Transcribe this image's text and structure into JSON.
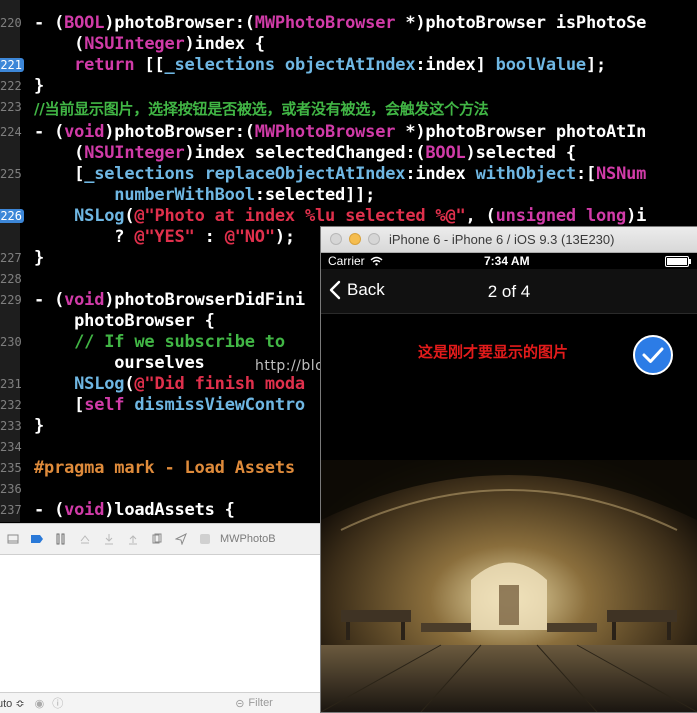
{
  "editor": {
    "line_numbers": [
      "220",
      "221",
      "222",
      "223",
      "224",
      "225",
      "226",
      "227",
      "228",
      "229",
      "230",
      "231",
      "232",
      "233",
      "234",
      "235",
      "236",
      "237"
    ],
    "lines": [
      "- (BOOL)photoBrowser:(MWPhotoBrowser *)photoBrowser isPhotoSe",
      "    (NSUInteger)index {",
      "    return [[_selections objectAtIndex:index] boolValue];",
      "}",
      "//当前显示图片，选择按钮是否被选，或者没有被选，会触发这个方法",
      "- (void)photoBrowser:(MWPhotoBrowser *)photoBrowser photoAtIn",
      "    (NSUInteger)index selectedChanged:(BOOL)selected {",
      "    [_selections replaceObjectAtIndex:index withObject:[NSNum",
      "        numberWithBool:selected]];",
      "    NSLog(@\"Photo at index %lu selected %@\", (unsigned long)i",
      "        ? @\"YES\" : @\"NO\");",
      "}",
      "",
      "- (void)photoBrowserDidFini",
      "    photoBrowser {",
      "    // If we subscribe to ",
      "        ourselves",
      "    NSLog(@\"Did finish moda",
      "    [self dismissViewContro",
      "}",
      "",
      "#pragma mark - Load Assets",
      "",
      "- (void)loadAssets {"
    ],
    "watermark": "http://blog.csdn.net/"
  },
  "debugbar": {
    "target_label": "MWPhotoB"
  },
  "bottombar": {
    "auto_label": "uto ≎",
    "filter_placeholder": "Filter"
  },
  "simulator": {
    "window_title": "iPhone 6 - iPhone 6 / iOS 9.3 (13E230)",
    "status": {
      "carrier": "Carrier",
      "time": "7:34 AM"
    },
    "nav": {
      "back_label": "Back",
      "title": "2 of 4"
    },
    "caption": "这是刚才要显示的图片",
    "photo_selected": true
  },
  "colors": {
    "keyword": "#d13ba8",
    "string": "#e0304c",
    "comment": "#41b645",
    "function": "#6fb7e3",
    "pragma": "#df8b3b",
    "breakpoint": "#3d87d8",
    "check_accent": "#2c7ce6",
    "caption": "#e31b1b"
  }
}
